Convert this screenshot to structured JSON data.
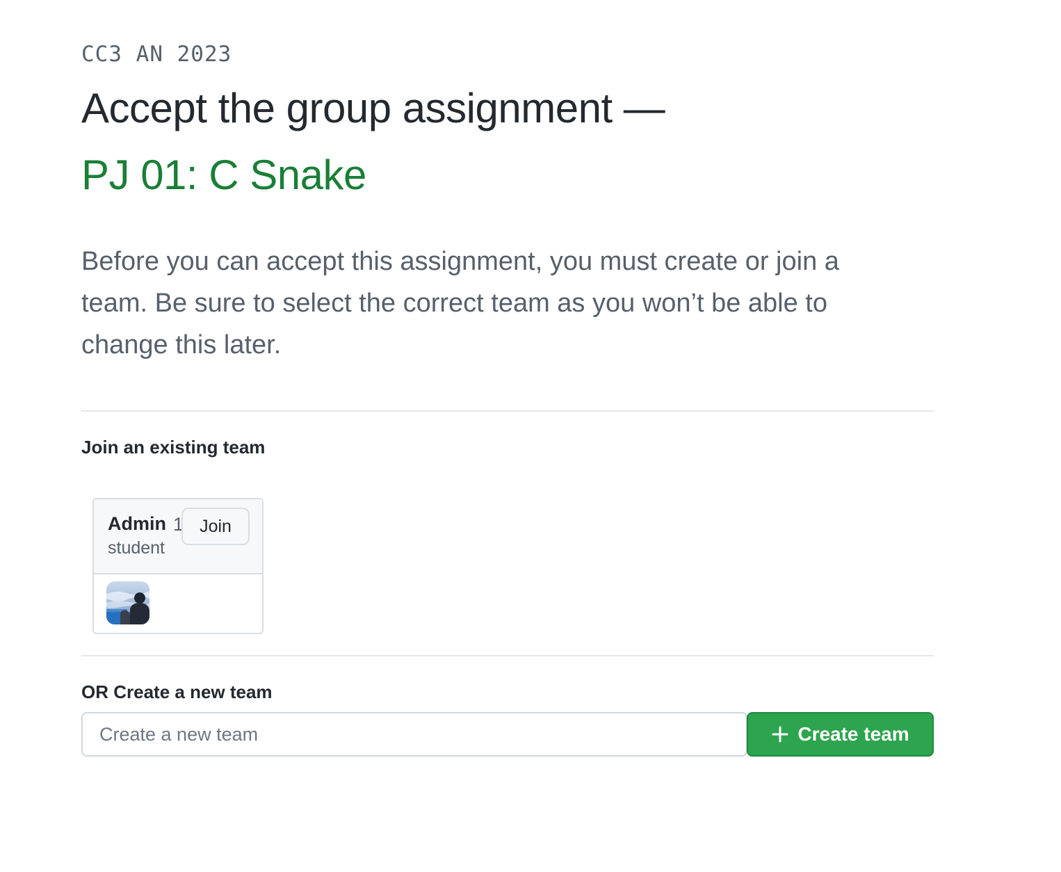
{
  "header": {
    "classroom_name": "CC3 AN 2023",
    "title": "Accept the group assignment —",
    "assignment_name": "PJ 01: C Snake"
  },
  "intro": {
    "text": "Before you can accept this assignment, you must create or join a team. Be sure to select the correct team as you won’t be able to change this later."
  },
  "join_section": {
    "heading": "Join an existing team",
    "teams": [
      {
        "name": "Admin",
        "member_count": "1",
        "member_unit": "student",
        "join_label": "Join",
        "avatar_icon": "member-avatar-photo"
      }
    ]
  },
  "create_section": {
    "heading": "OR Create a new team",
    "input_placeholder": "Create a new team",
    "input_value": "",
    "button_label": "Create team",
    "button_icon": "plus-icon"
  },
  "colors": {
    "accent_green": "#1a7f37",
    "button_green": "#2da44e",
    "muted_text": "#57606a",
    "border": "#d8dee4"
  }
}
